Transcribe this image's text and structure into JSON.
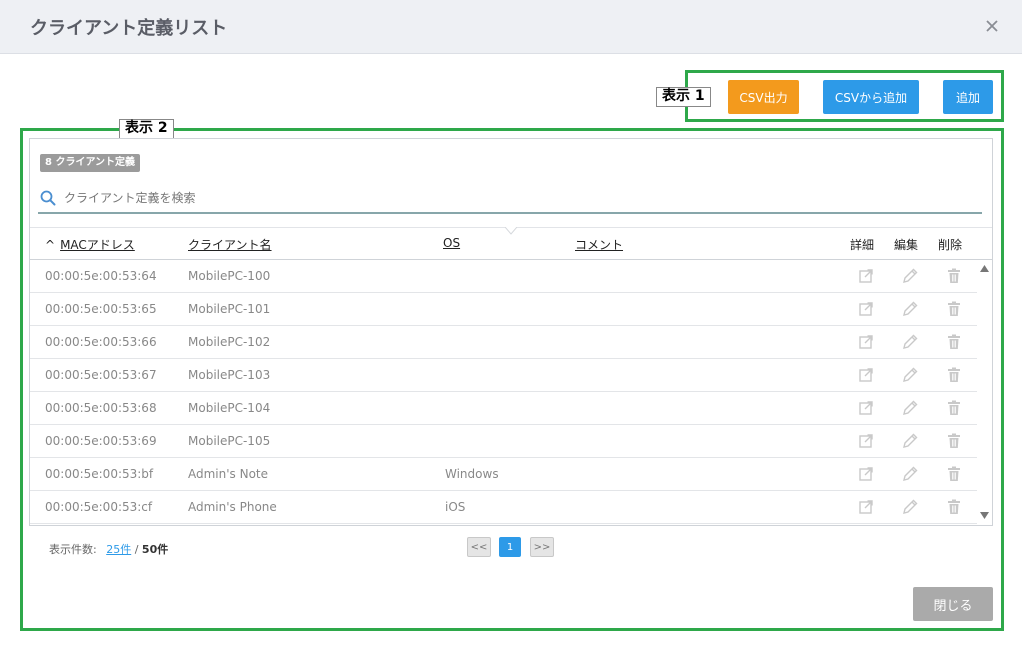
{
  "dialog": {
    "title": "クライアント定義リスト",
    "close_icon": "close-icon"
  },
  "annotations": {
    "label1": "表示 1",
    "label2": "表示 2",
    "color": "#2ea84a"
  },
  "toolbar": {
    "csv_export": "CSV出力",
    "csv_import": "CSVから追加",
    "add": "追加"
  },
  "list": {
    "count_badge": "8 クライアント定義",
    "search_placeholder": "クライアント定義を検索",
    "columns": {
      "mac": "MACアドレス",
      "mac_sort_indicator": "^",
      "name": "クライアント名",
      "os": "OS",
      "comment": "コメント",
      "detail": "詳細",
      "edit": "編集",
      "delete": "削除"
    },
    "rows": [
      {
        "mac": "00:00:5e:00:53:64",
        "name": "MobilePC-100",
        "os": "",
        "comment": ""
      },
      {
        "mac": "00:00:5e:00:53:65",
        "name": "MobilePC-101",
        "os": "",
        "comment": ""
      },
      {
        "mac": "00:00:5e:00:53:66",
        "name": "MobilePC-102",
        "os": "",
        "comment": ""
      },
      {
        "mac": "00:00:5e:00:53:67",
        "name": "MobilePC-103",
        "os": "",
        "comment": ""
      },
      {
        "mac": "00:00:5e:00:53:68",
        "name": "MobilePC-104",
        "os": "",
        "comment": ""
      },
      {
        "mac": "00:00:5e:00:53:69",
        "name": "MobilePC-105",
        "os": "",
        "comment": ""
      },
      {
        "mac": "00:00:5e:00:53:bf",
        "name": "Admin's Note",
        "os": "Windows",
        "comment": ""
      },
      {
        "mac": "00:00:5e:00:53:cf",
        "name": "Admin's Phone",
        "os": "iOS",
        "comment": ""
      }
    ]
  },
  "pagination": {
    "label": "表示件数:",
    "per_page": "25件",
    "separator": " / ",
    "total": "50件",
    "prev": "<<",
    "current": "1",
    "next": ">>"
  },
  "footer": {
    "close_button": "閉じる"
  },
  "colors": {
    "orange": "#f39a1d",
    "blue": "#2d9ae8",
    "grey_button": "#aaaaaa"
  }
}
